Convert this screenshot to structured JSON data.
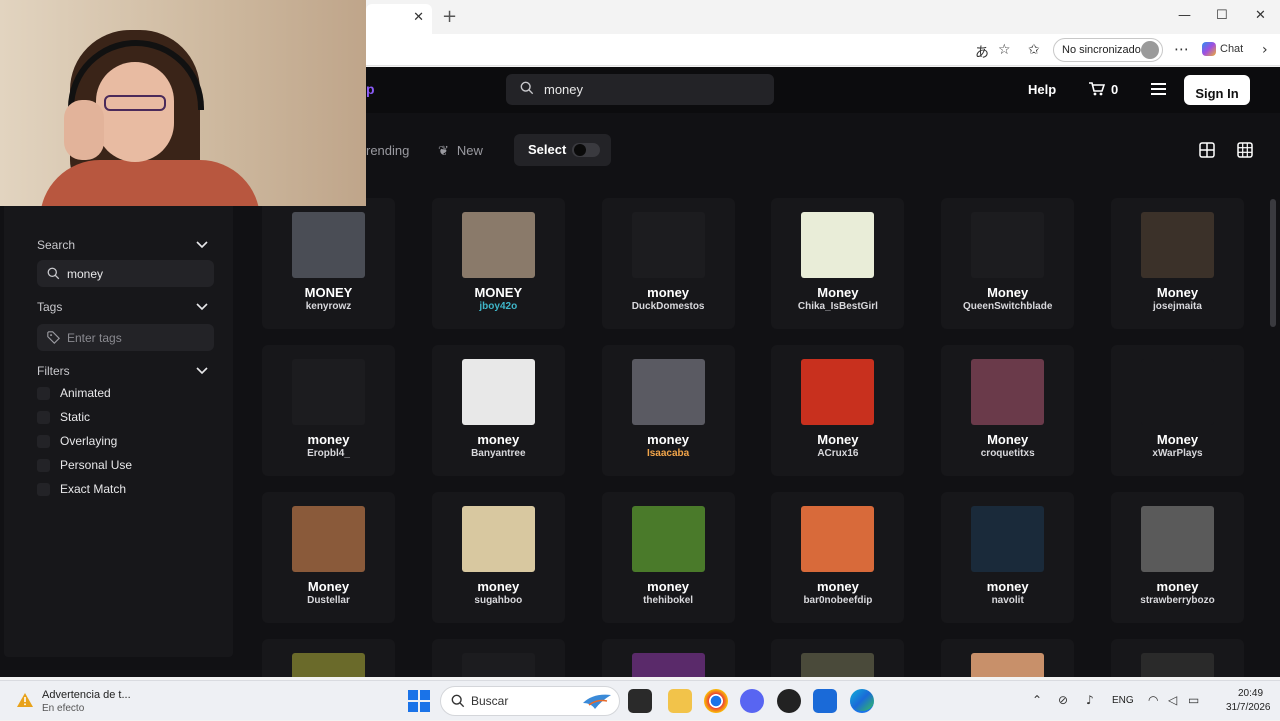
{
  "browser": {
    "tab_close": "✕",
    "new_tab": "+",
    "window": {
      "minimize": "—",
      "maximize": "☐",
      "close": "✕"
    },
    "sync_label": "No sincronizado",
    "more": "⋯",
    "chat_label": "Chat"
  },
  "navbar": {
    "logo_fragment": "p",
    "search_value": "money",
    "help": "Help",
    "cart_count": "0",
    "signin": "Sign In"
  },
  "toolbar": {
    "trending": "rending",
    "new": "New",
    "select": "Select"
  },
  "sidebar": {
    "search_section": "Search",
    "search_value": "money",
    "tags_section": "Tags",
    "tags_placeholder": "Enter tags",
    "filters_section": "Filters",
    "filters": [
      "Animated",
      "Static",
      "Overlaying",
      "Personal Use",
      "Exact Match"
    ]
  },
  "cards": [
    {
      "name": "MONEY",
      "user": "kenyrowz",
      "user_color": "#d8d8dc",
      "thumb": "#4a4d55"
    },
    {
      "name": "MONEY",
      "user": "jboy42o",
      "user_color": "#3fb6c9",
      "thumb": "#8a7a6a"
    },
    {
      "name": "money",
      "user": "DuckDomestos",
      "user_color": "#d8d8dc",
      "thumb": "#1c1c1f"
    },
    {
      "name": "Money",
      "user": "Chika_IsBestGirl",
      "user_color": "#d8d8dc",
      "thumb": "#e9edd8"
    },
    {
      "name": "Money",
      "user": "QueenSwitchblade",
      "user_color": "#d8d8dc",
      "thumb": "#1c1c1f"
    },
    {
      "name": "Money",
      "user": "josejmaita",
      "user_color": "#d8d8dc",
      "thumb": "#3b3129"
    },
    {
      "name": "money",
      "user": "Eropbl4_",
      "user_color": "#d8d8dc",
      "thumb": "#1c1c1f"
    },
    {
      "name": "money",
      "user": "Banyantree",
      "user_color": "#d8d8dc",
      "thumb": "#e8e8e8"
    },
    {
      "name": "money",
      "user": "Isaacaba",
      "user_color": "#f2a54a",
      "thumb": "#5a5a62"
    },
    {
      "name": "Money",
      "user": "ACrux16",
      "user_color": "#d8d8dc",
      "thumb": "#c8301e"
    },
    {
      "name": "Money",
      "user": "croquetitxs",
      "user_color": "#d8d8dc",
      "thumb": "#6a3a4a"
    },
    {
      "name": "Money",
      "user": "xWarPlays",
      "user_color": "#d8d8dc",
      "thumb": "#17171a"
    },
    {
      "name": "Money",
      "user": "Dustellar",
      "user_color": "#d8d8dc",
      "thumb": "#8a5a3a"
    },
    {
      "name": "money",
      "user": "sugahboo",
      "user_color": "#d8d8dc",
      "thumb": "#d8c8a0"
    },
    {
      "name": "money",
      "user": "thehibokel",
      "user_color": "#d8d8dc",
      "thumb": "#4a7a2a"
    },
    {
      "name": "money",
      "user": "bar0nobeefdip",
      "user_color": "#d8d8dc",
      "thumb": "#d86a3a"
    },
    {
      "name": "money",
      "user": "navolit",
      "user_color": "#d8d8dc",
      "thumb": "#1a2a3a"
    },
    {
      "name": "money",
      "user": "strawberrybozo",
      "user_color": "#d8d8dc",
      "thumb": "#5a5a5a"
    }
  ],
  "partial_cards": [
    "#6a6a2a",
    "#1c1c1f",
    "#5a2a6a",
    "#4a4a3a",
    "#c8906a",
    "#2a2a2a"
  ],
  "taskbar": {
    "weather_title": "Advertencia de t...",
    "weather_sub": "En efecto",
    "search_placeholder": "Buscar",
    "language": "ENG",
    "time": "20:49",
    "date": "31/7/2026"
  }
}
